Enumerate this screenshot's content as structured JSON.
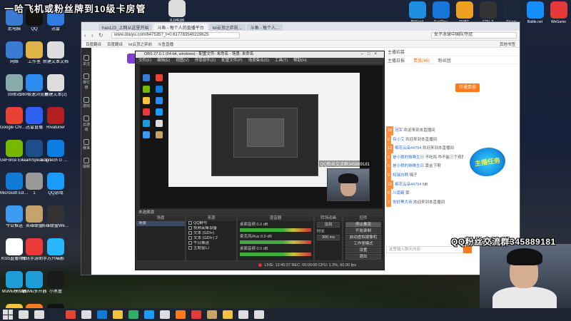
{
  "overlay": {
    "title": "一哈飞机或粉丝牌到10级卡房管",
    "qq_group": "QQ粉丝交流群345889181"
  },
  "desktop_left_icons": [
    {
      "label": "此电脑",
      "color": "#3a7bd5"
    },
    {
      "label": "网络",
      "color": "#3a7bd5"
    },
    {
      "label": "回收站",
      "color": "#8aa"
    },
    {
      "label": "Google Chrome",
      "color": "#e94235"
    },
    {
      "label": "GeForce Experience",
      "color": "#76b900"
    },
    {
      "label": "Microsoft Edge",
      "color": "#0f7bd5"
    },
    {
      "label": "今日推送",
      "color": "#3c9af0"
    },
    {
      "label": "KSS直播伴侣",
      "color": "#fff"
    },
    {
      "label": "MuMu模拟器",
      "color": "#1f9dd9"
    },
    {
      "label": "Bandizip",
      "color": "#f5c33b"
    }
  ],
  "desktop_col2_icons": [
    {
      "label": "QQ",
      "color": "#111"
    },
    {
      "label": "工作室",
      "color": "#e0b347"
    },
    {
      "label": "360极速浏览器",
      "color": "#2d8cf0"
    },
    {
      "label": "迅雷直播",
      "color": "#2d5ff0"
    },
    {
      "label": "TeamSpeak 3",
      "color": "#1c4e8a"
    },
    {
      "label": "1",
      "color": "#999"
    },
    {
      "label": "英雄联盟",
      "color": "#c5a36b"
    },
    {
      "label": "腾讯手游助手",
      "color": "#e93a3a"
    },
    {
      "label": "MuMu多开器",
      "color": "#1f9dd9"
    },
    {
      "label": "斗鱼直播",
      "color": "#ff7a1a"
    }
  ],
  "desktop_col3_icons": [
    {
      "label": "迅雷",
      "color": "#2f7be0"
    },
    {
      "label": "新建文本文档",
      "color": "#ddd"
    },
    {
      "label": "新建文本(2)",
      "color": "#ddd"
    },
    {
      "label": "Rivatuner",
      "color": "#b32020"
    },
    {
      "label": "Logitech G HUB",
      "color": "#0c7ee0"
    },
    {
      "label": "QQ游戏",
      "color": "#1a9bff"
    },
    {
      "label": "英雄联盟WeGame",
      "color": "#333"
    },
    {
      "label": "万兴喵影",
      "color": "#2ab6ff"
    },
    {
      "label": "小黑盒",
      "color": "#1a1a1a"
    },
    {
      "label": "剪映专业版",
      "color": "#111"
    }
  ],
  "top_right_icons": [
    {
      "label": "BitSpirit",
      "color": "#1e8fe0"
    },
    {
      "label": "SunRise",
      "color": "#1676d8"
    },
    {
      "label": "PUBG",
      "color": "#f0a020"
    },
    {
      "label": "CPU-Z",
      "color": "#333"
    },
    {
      "label": "Steam",
      "color": "#1b2838"
    },
    {
      "label": "Battle.net",
      "color": "#148eff"
    },
    {
      "label": "WeGame",
      "color": "#e63a3a"
    }
  ],
  "top_center_icon": {
    "label": "0.04GB",
    "color": "#ddd"
  },
  "browser": {
    "tabs": [
      "hao123_上网从这里开始",
      "斗鱼 - 每个人的直播平台",
      "lol云顶之弈前...",
      "斗鱼 - 每个人..."
    ],
    "url": "www.douyu.com/647535?_t=0.617783540219625",
    "search_placeholder": "女子冰球中国队夺冠",
    "bookmarks": [
      "百度翻译",
      "百度翻译",
      "lol云顶之弈前",
      "斗鱼直播"
    ],
    "bookmark_right": "其他书签"
  },
  "left_rail": [
    "关注",
    "排行榜",
    "游戏",
    "云游戏",
    "赛事",
    "视频"
  ],
  "chat": {
    "header": "主播招募",
    "tabs": [
      "主播日报",
      "贵族(46)",
      "粉丝团"
    ],
    "gift_button": "开通贵族",
    "rows": [
      {
        "level": "16",
        "user": "冠军",
        "text": "欢迎来到本直播间"
      },
      {
        "level": "8",
        "user": "有小艾",
        "text": "欢迎来到本直播间"
      },
      {
        "level": "12",
        "user": "棉花云朵44754",
        "text": "欢迎来到本直播间"
      },
      {
        "level": "5",
        "user": "是小狼的啾啾生日",
        "text": "不吃鸡 咋不能三个观摩"
      },
      {
        "level": "5",
        "user": "是小狼的啾啾生日",
        "text": "黄金下啊"
      },
      {
        "level": "9",
        "user": "知瑞白啊",
        "text": "嗨子"
      },
      {
        "level": "12",
        "user": "棉花云朵44754",
        "text": "NB"
      },
      {
        "level": "6",
        "user": "川南霸",
        "text": "菜"
      },
      {
        "level": "7",
        "user": "你好黑大帝",
        "text": "欢迎来到本直播间"
      }
    ],
    "input_placeholder": "这里输入聊天内容"
  },
  "fans_badge": "主播任务",
  "obs": {
    "title": "OBS 27.0.1 (64-bit, windows) - 配置文件: 未命名 - 场景: 未命名",
    "menu": [
      "文件(F)",
      "编辑(E)",
      "视图(V)",
      "停靠部件(D)",
      "配置文件(P)",
      "场景集合(S)",
      "工具(T)",
      "帮助(H)"
    ],
    "preview_caption": "QQ粉丝交流群345889181",
    "scene_bar": "未选择源",
    "dock_titles": [
      "场景",
      "来源",
      "混音器",
      "转场动画",
      "控件"
    ],
    "scene_item": "场景",
    "sources": [
      "QQ群号",
      "视频采集设备",
      "文本 (GDI+)",
      "文本 (GDI+) 2",
      "午日推送",
      "主题窗口"
    ],
    "mixer": [
      {
        "name": "桌面音频",
        "value": "0.0 dB"
      },
      {
        "name": "麦克风/Aux",
        "value": "0.0 dB"
      },
      {
        "name": "桌面音频",
        "value": "0.0 dB"
      }
    ],
    "transition": {
      "name": "淡出",
      "duration_label": "时长",
      "duration": "300 ms"
    },
    "controls": [
      "停止推流",
      "开始录制",
      "启动虚拟摄像机",
      "工作室模式",
      "设置",
      "退出"
    ],
    "status": "LIVE: 12:45:37  REC: 00:00:00  CPU: 1.3%, 60.00 fps"
  },
  "taskbar": {
    "apps": [
      {
        "name": "search",
        "color": "#ddd"
      },
      {
        "name": "task-view",
        "color": "#ddd"
      },
      {
        "name": "steam",
        "color": "#1b2838"
      },
      {
        "name": "chrome",
        "color": "#e94235"
      },
      {
        "name": "obs",
        "color": "#ddd"
      },
      {
        "name": "edge",
        "color": "#0f7bd5"
      },
      {
        "name": "folder",
        "color": "#f5c33b"
      },
      {
        "name": "wechat",
        "color": "#2bae66"
      },
      {
        "name": "qq",
        "color": "#1a9bff"
      },
      {
        "name": "cloud",
        "color": "#ddd"
      },
      {
        "name": "douyu",
        "color": "#ff7a1a"
      },
      {
        "name": "record",
        "color": "#e63a3a"
      },
      {
        "name": "game",
        "color": "#c5a36b"
      },
      {
        "name": "folder2",
        "color": "#f5c33b"
      },
      {
        "name": "chat",
        "color": "#ddd"
      },
      {
        "name": "store",
        "color": "#ddd"
      }
    ]
  }
}
